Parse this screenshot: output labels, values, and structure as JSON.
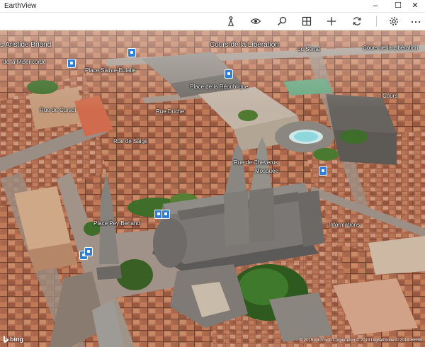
{
  "window": {
    "title": "EarthView",
    "min": "–",
    "max": "☐",
    "close": "✕"
  },
  "toolbar": {
    "items": [
      {
        "name": "streetside-person-icon"
      },
      {
        "name": "view-eye-icon"
      },
      {
        "name": "search-icon"
      },
      {
        "name": "map-grid-icon"
      },
      {
        "name": "add-plus-icon"
      },
      {
        "name": "rotate-icon"
      },
      {
        "name": "settings-gear-icon"
      },
      {
        "name": "more-ellipsis-icon"
      }
    ]
  },
  "map": {
    "labels": {
      "aristide": "s Aristide Briand",
      "cours_liberation": "Cours de la Libération",
      "cours_liberation_2": "Cours de la Libération",
      "mericorde": "de la Miséricorde",
      "sainte_eulalie": "Place Sainte-Eulalie",
      "republique": "Place de la République",
      "rue_cursol": "Rue de Cursol",
      "rue_duche": "Rue Duché",
      "rue_saige": "Rue de Saige",
      "pey_berland": "Place Pey Berland",
      "hotel": "Informations",
      "senat": "du Sénat",
      "mosquee": "Mosquée",
      "gambetta": "Rue de Cheverus",
      "cours": "Cours"
    },
    "credits": {
      "brand": "bing",
      "copyright": "© 2019 Microsoft Corporation  © 2019 DigitalGlobe  © 2019 HERE"
    }
  }
}
